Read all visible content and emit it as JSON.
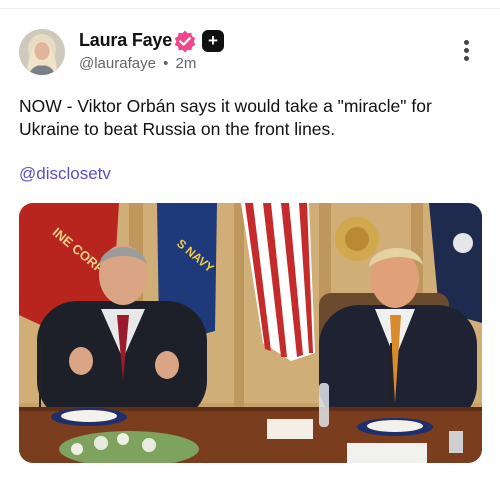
{
  "post": {
    "author_name": "Laura Faye",
    "handle": "@laurafaye",
    "separator": "•",
    "time": "2m",
    "plus_badge": "+",
    "body": "NOW - Viktor Orbán says it would take a \"miracle\" for Ukraine to beat Russia on the front lines.",
    "mention": "@disclosetv"
  },
  "icons": {
    "verified": "verified-flower-icon",
    "plus": "plus-badge-icon",
    "more": "more-vertical-icon"
  },
  "colors": {
    "verified": "#f0468b",
    "mention": "#5a4fc8",
    "text": "#111111",
    "muted": "#666666"
  },
  "media": {
    "flag_text_left": "INE CORPS",
    "flag_text_blue": "S NAVY"
  }
}
